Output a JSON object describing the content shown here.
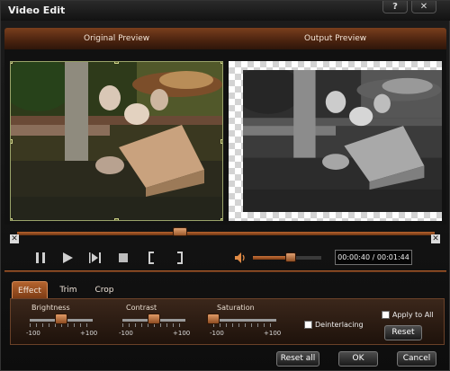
{
  "window": {
    "title": "Video Edit",
    "help_label": "?",
    "close_label": "✕"
  },
  "preview": {
    "original_label": "Original Preview",
    "output_label": "Output Preview"
  },
  "timeline": {
    "position": 0.39,
    "start_marker": "✕",
    "end_marker": "✕"
  },
  "controls": {
    "icons": [
      "pause-icon",
      "play-icon",
      "next-frame-icon",
      "stop-icon",
      "mark-in-icon",
      "mark-out-icon"
    ],
    "volume_level": 0.55,
    "time_display": "00:00:40 / 00:01:44"
  },
  "tabs": [
    {
      "label": "Effect",
      "active": true
    },
    {
      "label": "Trim",
      "active": false
    },
    {
      "label": "Crop",
      "active": false
    }
  ],
  "effect": {
    "sliders": [
      {
        "label": "Brightness",
        "min": "-100",
        "max": "+100",
        "value": 0
      },
      {
        "label": "Contrast",
        "min": "-100",
        "max": "+100",
        "value": 0
      },
      {
        "label": "Saturation",
        "min": "-100",
        "max": "+100",
        "value": -100
      }
    ],
    "deinterlacing_label": "Deinterlacing",
    "deinterlacing_checked": false,
    "apply_to_all_label": "Apply to All",
    "apply_to_all_checked": false,
    "reset_label": "Reset"
  },
  "footer": {
    "reset_all_label": "Reset all",
    "ok_label": "OK",
    "cancel_label": "Cancel"
  },
  "colors": {
    "accent": "#b3632e",
    "panel": "#1e120b",
    "track": "#7a3a14"
  }
}
